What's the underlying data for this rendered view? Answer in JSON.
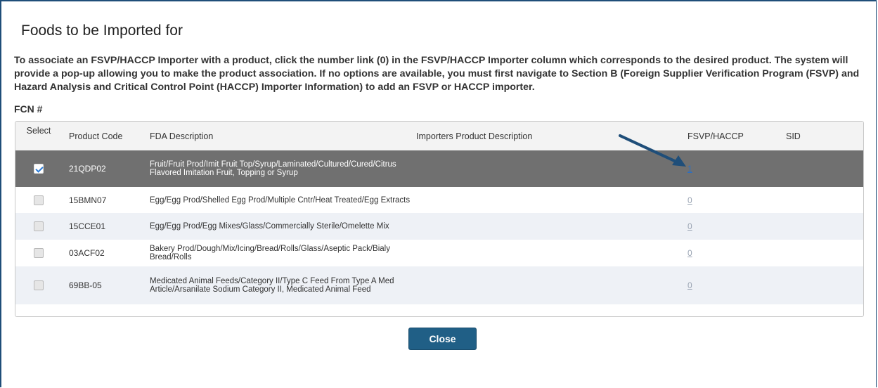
{
  "dialog": {
    "title": "Foods to be Imported for",
    "instructions": "To associate an FSVP/HACCP Importer with a product, click the number link (0) in the FSVP/HACCP Importer column which corresponds to the desired product. The system will provide a pop-up allowing you to make the product association. If no options are available, you must first navigate to Section B (Foreign Supplier Verification Program (FSVP) and Hazard Analysis and Critical Control Point (HACCP) Importer Information) to add an FSVP or HACCP importer.",
    "fcn_label": "FCN #",
    "close_label": "Close"
  },
  "table": {
    "headers": {
      "select": "Select",
      "product_code": "Product Code",
      "fda_description": "FDA Description",
      "importers_description": "Importers Product Description",
      "fsvp_haccp": "FSVP/HACCP",
      "sid": "SID"
    },
    "rows": [
      {
        "selected": true,
        "product_code": "21QDP02",
        "fda_description": "Fruit/Fruit Prod/Imit Fruit Top/Syrup/Laminated/Cultured/Cured/Citrus Flavored Imitation Fruit, Topping or Syrup",
        "importers_description": "",
        "fsvp_haccp": "1",
        "sid": ""
      },
      {
        "selected": false,
        "product_code": "15BMN07",
        "fda_description": "Egg/Egg Prod/Shelled Egg Prod/Multiple Cntr/Heat Treated/Egg Extracts",
        "importers_description": "",
        "fsvp_haccp": "0",
        "sid": ""
      },
      {
        "selected": false,
        "product_code": "15CCE01",
        "fda_description": "Egg/Egg Prod/Egg Mixes/Glass/Commercially Sterile/Omelette Mix",
        "importers_description": "",
        "fsvp_haccp": "0",
        "sid": ""
      },
      {
        "selected": false,
        "product_code": "03ACF02",
        "fda_description": "Bakery Prod/Dough/Mix/Icing/Bread/Rolls/Glass/Aseptic Pack/Bialy Bread/Rolls",
        "importers_description": "",
        "fsvp_haccp": "0",
        "sid": ""
      },
      {
        "selected": false,
        "product_code": "69BB-05",
        "fda_description": "Medicated Animal Feeds/Category II/Type C Feed From Type A Med Article/Arsanilate Sodium Category II, Medicated Animal Feed",
        "importers_description": "",
        "fsvp_haccp": "0",
        "sid": ""
      }
    ]
  },
  "colors": {
    "dialog_border": "#1f4e79",
    "selected_row": "#707070",
    "alt_row": "#eef1f6",
    "close_button": "#205f86",
    "annotation_arrow": "#1f4e79",
    "active_link": "#2a6fc4"
  },
  "annotation": {
    "icon": "arrow-icon"
  }
}
